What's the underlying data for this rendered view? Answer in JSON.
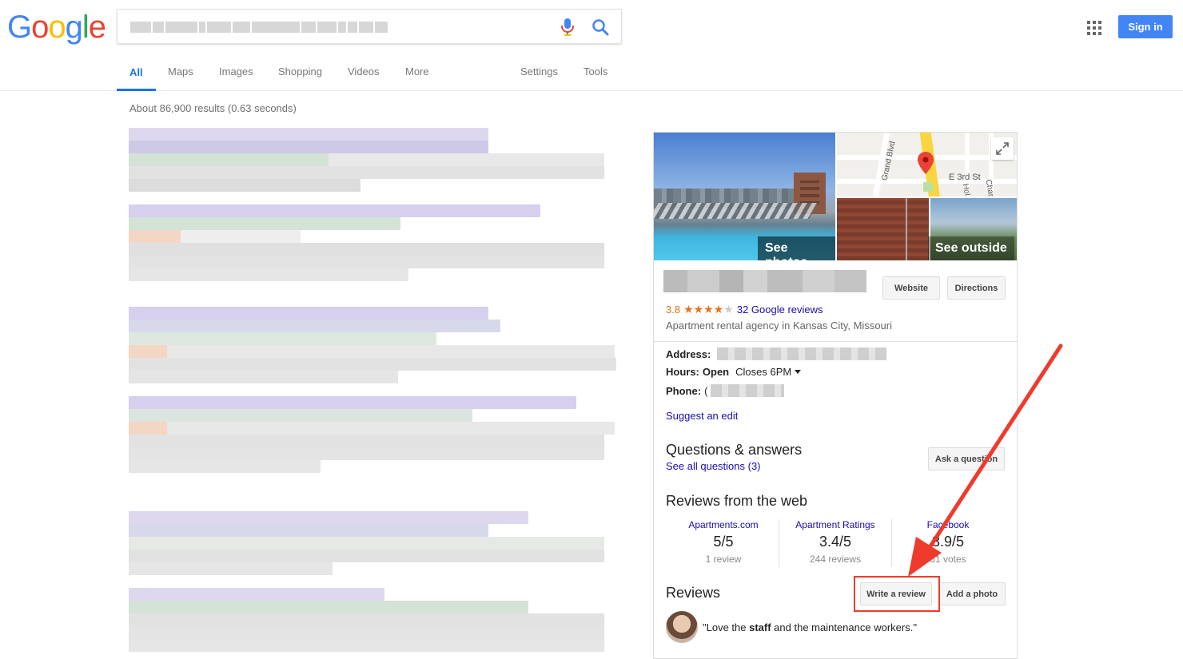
{
  "logo": {
    "letters": [
      "G",
      "o",
      "o",
      "g",
      "l",
      "e"
    ],
    "colors": [
      "#4285f4",
      "#ea4335",
      "#fbbc05",
      "#4285f4",
      "#34a853",
      "#ea4335"
    ]
  },
  "header": {
    "signin_label": "Sign in"
  },
  "tabs": [
    {
      "label": "All",
      "active": true
    },
    {
      "label": "Maps",
      "active": false
    },
    {
      "label": "Images",
      "active": false
    },
    {
      "label": "Shopping",
      "active": false
    },
    {
      "label": "Videos",
      "active": false
    },
    {
      "label": "More",
      "active": false
    },
    {
      "label": "Settings",
      "active": false
    },
    {
      "label": "Tools",
      "active": false
    }
  ],
  "results_stats": "About 86,900 results (0.63 seconds)",
  "knowledge_panel": {
    "photo_labels": {
      "see_photos": "See photos",
      "see_outside": "See outside"
    },
    "map_labels": {
      "street1": "Grand Blvd",
      "street2": "E 3rd St",
      "street3": "Hol",
      "street4": "Char"
    },
    "buttons": {
      "website": "Website",
      "directions": "Directions"
    },
    "rating": {
      "score": "3.8",
      "stars_filled": 4,
      "stars_total": 5,
      "reviews_link": "32 Google reviews"
    },
    "type": "Apartment rental agency in Kansas City, Missouri",
    "facts": {
      "address_label": "Address:",
      "hours_label": "Hours:",
      "hours_status": "Open",
      "hours_detail": "Closes 6PM",
      "phone_label": "Phone:",
      "phone_prefix": "("
    },
    "suggest_edit": "Suggest an edit",
    "qa": {
      "title": "Questions & answers",
      "link": "See all questions (3)",
      "button": "Ask a question"
    },
    "web_reviews": {
      "title": "Reviews from the web",
      "sources": [
        {
          "name": "Apartments.com",
          "score": "5/5",
          "count": "1 review"
        },
        {
          "name": "Apartment Ratings",
          "score": "3.4/5",
          "count": "244 reviews"
        },
        {
          "name": "Facebook",
          "score": "3.9/5",
          "count": "31 votes"
        }
      ]
    },
    "reviews": {
      "title": "Reviews",
      "write_button": "Write a review",
      "photo_button": "Add a photo",
      "quote_open": "\"Love the ",
      "quote_bold": "staff",
      "quote_close": " and the maintenance workers.\""
    }
  },
  "annotation": {
    "arrow_color": "#ef3b2c",
    "box_color": "#ef3b2c"
  }
}
